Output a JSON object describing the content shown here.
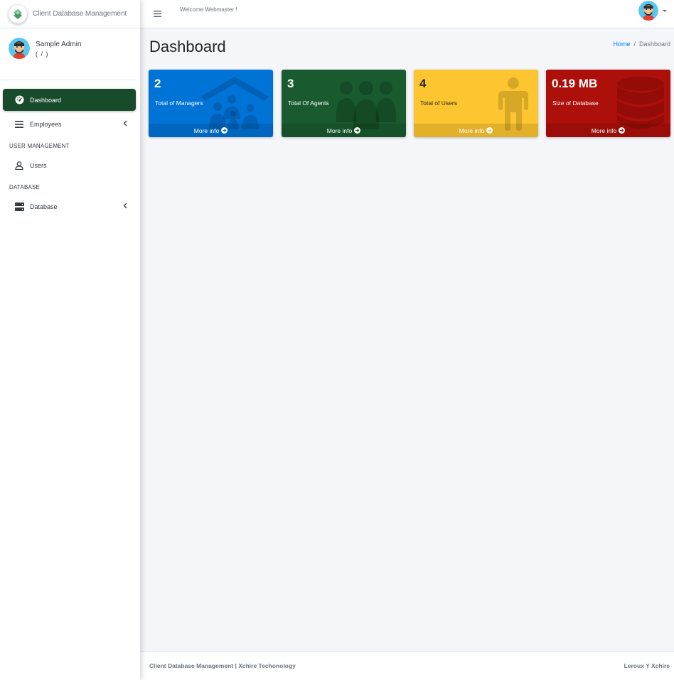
{
  "brand": {
    "title": "Client Database Management"
  },
  "user_panel": {
    "name": "Sample Admin",
    "role": "( / )"
  },
  "nav": {
    "dashboard": "Dashboard",
    "employees": "Employees",
    "user_management_header": "USER MANAGEMENT",
    "users": "Users",
    "database_header": "DATABASE",
    "database": "Database"
  },
  "topbar": {
    "welcome": "Welcome Webmaster !"
  },
  "page": {
    "title": "Dashboard",
    "breadcrumb": {
      "home": "Home",
      "separator": "/",
      "current": "Dashboard"
    }
  },
  "boxes": [
    {
      "value": "2",
      "label": "Total of Managers",
      "more": "More info",
      "color": "#0073d6",
      "icon": "house-family-icon"
    },
    {
      "value": "3",
      "label": "Total Of Agents",
      "more": "More info",
      "color": "#195b2f",
      "icon": "users-group-icon"
    },
    {
      "value": "4",
      "label": "Total of Users",
      "more": "More info",
      "color": "#fdc52f",
      "icon": "person-icon"
    },
    {
      "value": "0.19 MB",
      "label": "Size of Database",
      "more": "More info",
      "color": "#ad0f0a",
      "icon": "database-icon"
    }
  ],
  "footer": {
    "left": "Client Database Management | Xchire Techonology",
    "right": "Leroux Y Xchire"
  },
  "colors": {
    "sidebar_active": "#184a2c",
    "link": "#007bff",
    "content_bg": "#f4f6f9"
  }
}
